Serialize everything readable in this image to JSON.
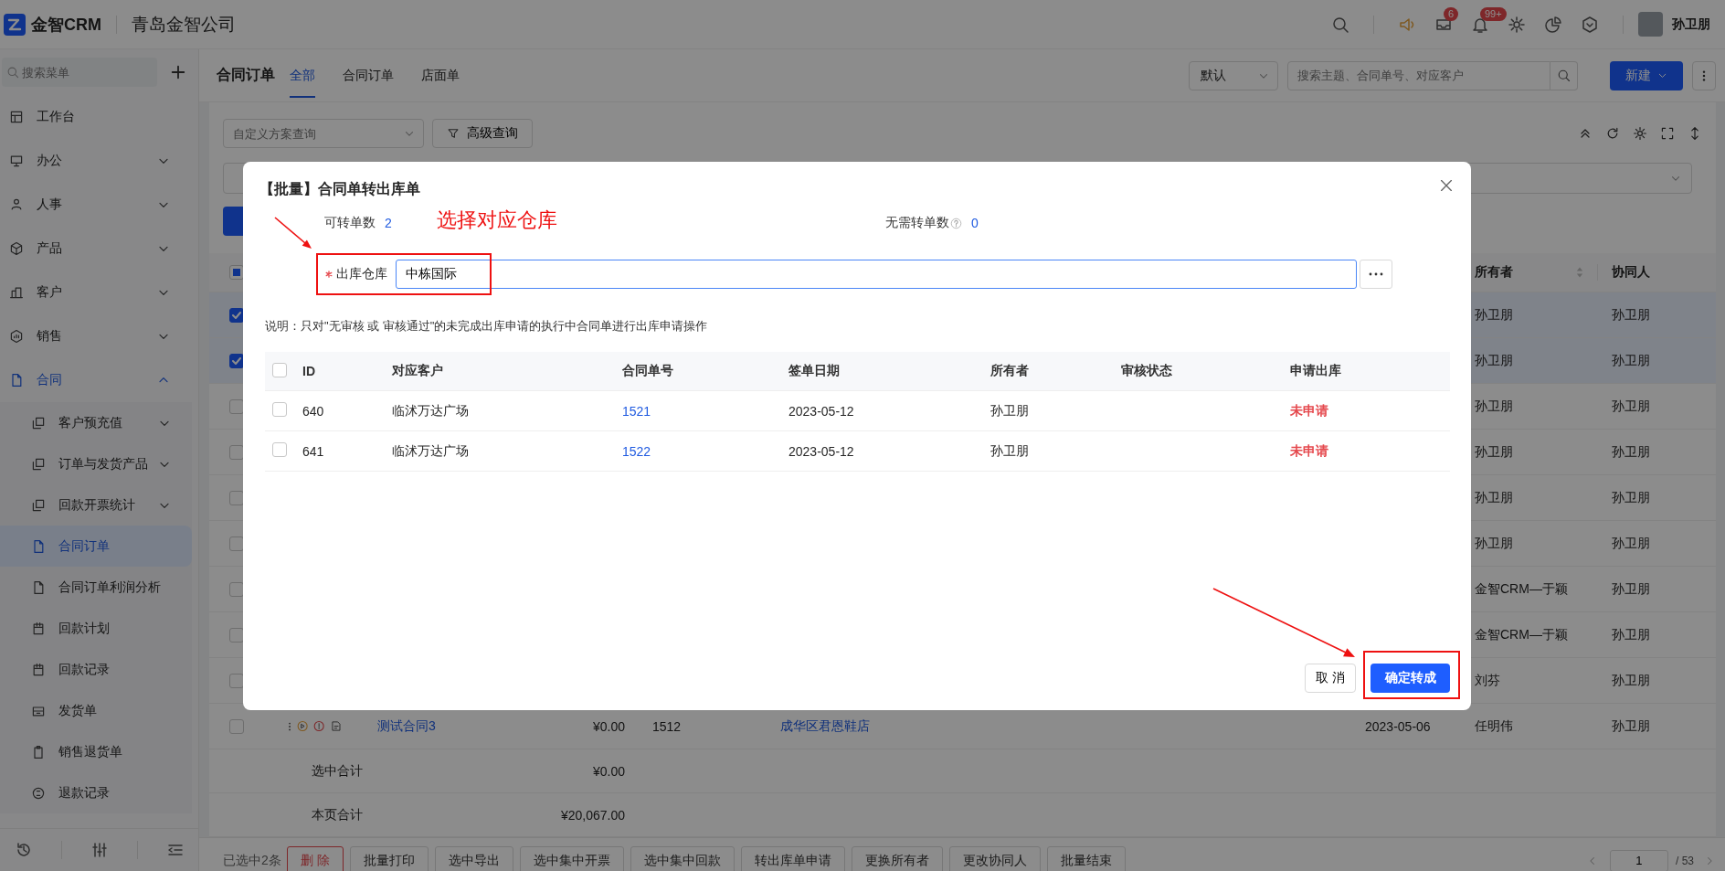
{
  "header": {
    "logo_text": "金智CRM",
    "company": "青岛金智公司",
    "message_badge": "6",
    "notification_badge": "99+",
    "user_name": "孙卫朋"
  },
  "sidebar": {
    "search_placeholder": "搜索菜单",
    "items": [
      {
        "label": "工作台",
        "selected": false
      },
      {
        "label": "办公",
        "selected": false,
        "expanded": false
      },
      {
        "label": "人事",
        "selected": false,
        "expanded": false
      },
      {
        "label": "产品",
        "selected": false,
        "expanded": false
      },
      {
        "label": "客户",
        "selected": false,
        "expanded": false
      },
      {
        "label": "销售",
        "selected": false,
        "expanded": false
      },
      {
        "label": "合同",
        "selected": false,
        "expanded": true,
        "children": [
          {
            "label": "客户预充值",
            "selected": false,
            "expanded": false
          },
          {
            "label": "订单与发货产品",
            "selected": false,
            "expanded": false
          },
          {
            "label": "回款开票统计",
            "selected": false,
            "expanded": false
          },
          {
            "label": "合同订单",
            "selected": true
          },
          {
            "label": "合同订单利润分析",
            "selected": false
          },
          {
            "label": "回款计划",
            "selected": false
          },
          {
            "label": "回款记录",
            "selected": false
          },
          {
            "label": "发货单",
            "selected": false
          },
          {
            "label": "销售退货单",
            "selected": false
          },
          {
            "label": "退款记录",
            "selected": false
          }
        ]
      }
    ]
  },
  "page": {
    "title": "合同订单",
    "tabs": [
      {
        "label": "全部",
        "selected": true
      },
      {
        "label": "合同订单",
        "selected": false
      },
      {
        "label": "店面单",
        "selected": false
      }
    ],
    "view_select": "默认",
    "search_placeholder": "搜索主题、合同单号、对应客户",
    "new_button": "新建"
  },
  "filter": {
    "scheme_placeholder": "自定义方案查询",
    "advanced_button": "高级查询"
  },
  "table": {
    "header_indeterminate": true,
    "columns": [
      {
        "label": "所有者",
        "sortable": true
      },
      {
        "label": "协同人"
      }
    ],
    "rows": [
      {
        "selected": true,
        "owner": "孙卫朋",
        "collaborator": "孙卫朋"
      },
      {
        "selected": true,
        "owner": "孙卫朋",
        "collaborator": "孙卫朋"
      },
      {
        "selected": false,
        "owner": "孙卫朋",
        "collaborator": "孙卫朋"
      },
      {
        "selected": false,
        "owner": "孙卫朋",
        "collaborator": "孙卫朋"
      },
      {
        "selected": false,
        "owner": "孙卫朋",
        "collaborator": "孙卫朋"
      },
      {
        "selected": false,
        "owner": "孙卫朋",
        "collaborator": "孙卫朋"
      },
      {
        "selected": false,
        "owner": "金智CRM—于颖",
        "collaborator": "孙卫朋"
      },
      {
        "selected": false,
        "owner": "金智CRM—于颖",
        "collaborator": "孙卫朋"
      },
      {
        "selected": false,
        "owner": "刘芬",
        "collaborator": "孙卫朋"
      },
      {
        "selected": false,
        "title": "测试合同3",
        "amount": "¥0.00",
        "contract_no": "1512",
        "customer": "成华区君恩鞋店",
        "date": "2023-05-06",
        "owner": "任明伟",
        "collaborator": "孙卫朋"
      }
    ],
    "totals": [
      {
        "label": "选中合计",
        "value": "¥0.00"
      },
      {
        "label": "本页合计",
        "value": "¥20,067.00"
      }
    ]
  },
  "bottom_bar": {
    "selected_count": "已选中2条",
    "actions": [
      {
        "label": "删 除",
        "kind": "danger"
      },
      {
        "label": "批量打印",
        "kind": "default"
      },
      {
        "label": "选中导出",
        "kind": "default"
      },
      {
        "label": "选中集中开票",
        "kind": "default"
      },
      {
        "label": "选中集中回款",
        "kind": "default"
      },
      {
        "label": "转出库单申请",
        "kind": "default"
      },
      {
        "label": "更换所有者",
        "kind": "default"
      },
      {
        "label": "更改协同人",
        "kind": "default"
      },
      {
        "label": "批量结束",
        "kind": "default"
      }
    ],
    "pagination": {
      "page": "1",
      "total": "/ 53"
    }
  },
  "modal": {
    "title": "【批量】合同单转出库单",
    "stats": [
      {
        "label": "可转单数",
        "value": "2"
      },
      {
        "label": "无需转单数",
        "value": "0",
        "help": true
      }
    ],
    "field": {
      "label": "出库仓库",
      "required": true,
      "value": "中栋国际"
    },
    "note": "说明：只对\"无审核 或 审核通过\"的未完成出库申请的执行中合同单进行出库申请操作",
    "table": {
      "header_checked": false,
      "columns": [
        "ID",
        "对应客户",
        "合同单号",
        "签单日期",
        "所有者",
        "审核状态",
        "申请出库"
      ],
      "rows": [
        {
          "selected": false,
          "id": "640",
          "customer": "临沭万达广场",
          "contract_no": "1521",
          "date": "2023-05-12",
          "owner": "孙卫朋",
          "status": "未申请"
        },
        {
          "selected": false,
          "id": "641",
          "customer": "临沭万达广场",
          "contract_no": "1522",
          "date": "2023-05-12",
          "owner": "孙卫朋",
          "status": "未申请"
        }
      ]
    },
    "cancel_button": "取 消",
    "confirm_button": "确定转成"
  },
  "annotation": {
    "text": "选择对应仓库"
  }
}
